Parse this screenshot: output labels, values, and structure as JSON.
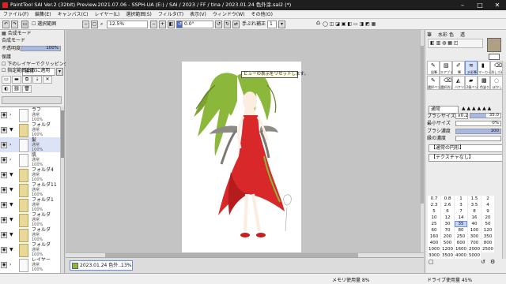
{
  "window": {
    "title": "PaintTool SAI Ver.2 (32bit) Preview.2021.07.06 - SSPH-UA (E:) / SAI / 2023 / FF / tina / 2023.01.24 色外涂.sai2 (*)"
  },
  "menu": [
    "ファイル(F)",
    "編集(E)",
    "キャンバス(C)",
    "レイヤー(L)",
    "選択範囲(S)",
    "フィルタ(T)",
    "表示(V)",
    "ウィンドウ(W)",
    "その他(O)"
  ],
  "toolbar": {
    "selection_display": "選択範囲",
    "zoom": "12.5%",
    "angle": "0.0°",
    "stabilizer_label": "手ぶれ補正",
    "stabilizer_value": "1",
    "tooltip": "ビューの表示をリセットします。"
  },
  "left_panel": {
    "header": "合成モード",
    "blend_mode": "通常",
    "opacity_label": "不透明度",
    "opacity_value": "100%",
    "protect_label": "保護",
    "clip_label": "下のレイヤーでクリッピング",
    "ref_label": "指定範囲出取に適用"
  },
  "layers": [
    {
      "name": "ラフ",
      "mode": "通常",
      "opacity": "100%",
      "folder": false,
      "selected": false
    },
    {
      "name": "フォルダ",
      "mode": "通常",
      "opacity": "100%",
      "folder": true,
      "selected": false
    },
    {
      "name": "髪",
      "mode": "通常",
      "opacity": "100%",
      "folder": false,
      "selected": true
    },
    {
      "name": "肌",
      "mode": "通常",
      "opacity": "100%",
      "folder": false,
      "selected": false
    },
    {
      "name": "フォルダ4",
      "mode": "通常",
      "opacity": "100%",
      "folder": true,
      "selected": false
    },
    {
      "name": "フォルダ11",
      "mode": "通常",
      "opacity": "100%",
      "folder": true,
      "selected": false
    },
    {
      "name": "フォルダ1",
      "mode": "通常",
      "opacity": "100%",
      "folder": true,
      "selected": false
    },
    {
      "name": "フォルダ",
      "mode": "通常",
      "opacity": "100%",
      "folder": true,
      "selected": false
    },
    {
      "name": "フォルダ",
      "mode": "通常",
      "opacity": "100%",
      "folder": true,
      "selected": false
    },
    {
      "name": "フォルダ",
      "mode": "通常",
      "opacity": "100%",
      "folder": true,
      "selected": false
    },
    {
      "name": "レイヤー",
      "mode": "通常",
      "opacity": "100%",
      "folder": false,
      "selected": false
    }
  ],
  "doc_tab": {
    "name": "2023.01.24 色外...",
    "zoom": "13%"
  },
  "right_panel": {
    "tabs": [
      "筆",
      "水彩",
      "色",
      "透"
    ],
    "brush_names": [
      "鉛筆",
      "エアブラシ",
      "筆",
      "水彩筆",
      "マーカー",
      "消しゴム",
      "選択ペン",
      "選択消し",
      "バケツ",
      "2値ペン",
      "色塗り",
      "ぼかし"
    ],
    "blend": "通常",
    "brush_size_label": "ブラシサイズ",
    "brush_size_mult": "x0.2",
    "brush_size_value": "35.0",
    "min_size_label": "最小サイズ",
    "min_size_value": "0%",
    "density_label": "ブラシ濃度",
    "density_value": "100",
    "edge_label": "縁の濃度",
    "shape_label": "【通常の円形】",
    "texture_label": "【テクスチャなし】",
    "sizes": [
      "0.7",
      "0.8",
      "1",
      "1.5",
      "2",
      "2.3",
      "2.6",
      "3",
      "3.5",
      "4",
      "5",
      "6",
      "7",
      "8",
      "9",
      "10",
      "12",
      "14",
      "16",
      "20",
      "25",
      "30",
      "35",
      "40",
      "50",
      "60",
      "70",
      "80",
      "100",
      "120",
      "160",
      "200",
      "250",
      "300",
      "350",
      "400",
      "500",
      "600",
      "700",
      "800",
      "1000",
      "1200",
      "1600",
      "2000",
      "2500",
      "3000",
      "3500",
      "4000",
      "5000"
    ],
    "selected_size": "35"
  },
  "status": {
    "memory": "メモリ使用量 8%",
    "disk": "ドライブ使用量 45%"
  }
}
